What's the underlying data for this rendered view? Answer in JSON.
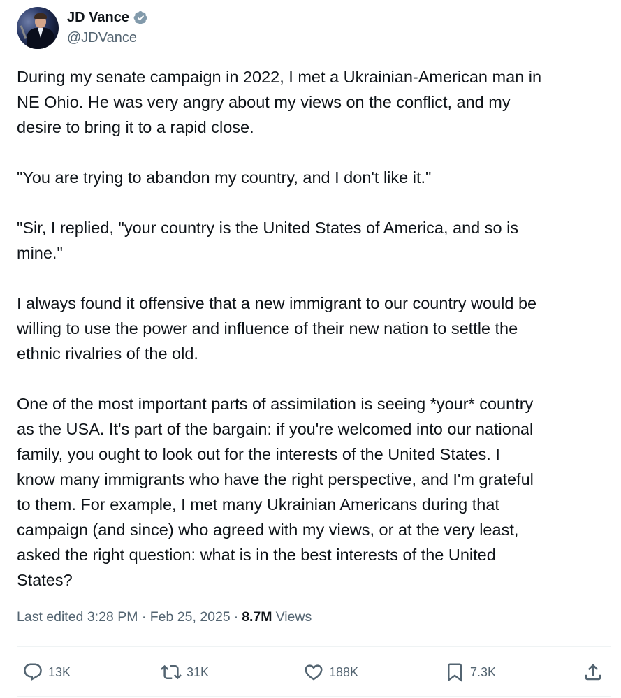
{
  "author": {
    "display_name": "JD Vance",
    "handle": "@JDVance",
    "verified_badge": "verified-badge-icon",
    "badge_color": "#829aab"
  },
  "tweet": {
    "paragraphs": [
      "During my senate campaign in 2022, I met a Ukrainian-American man in\nNE Ohio. He was very angry about my views on the conflict, and my\ndesire to bring it to a rapid close.",
      "\"You are trying to abandon my country, and I don't like it.\"",
      "\"Sir, I replied, \"your country is the United States of America, and so is\nmine.\"",
      "I always found it offensive that a new immigrant to our country would be\nwilling to use the power and influence of their new nation to settle the\nethnic rivalries of the old.",
      "One of the most important parts of assimilation is seeing *your* country\nas the USA. It's part of the bargain: if you're welcomed into our national\nfamily, you ought to look out for the interests of the United States.  I\nknow many immigrants who have the right perspective, and I'm grateful\nto them. For example, I met many Ukrainian Americans during that\ncampaign (and since) who agreed with my views, or at the very least,\nasked the right question: what is in the best interests of the United\nStates?"
    ]
  },
  "meta": {
    "timestamp": "Last edited 3:28 PM · Feb 25, 2025",
    "separator": "·",
    "views_count": "8.7M",
    "views_label": "Views"
  },
  "actions": {
    "reply_count": "13K",
    "retweet_count": "31K",
    "like_count": "188K",
    "bookmark_count": "7.3K",
    "icons": [
      "reply-icon",
      "retweet-icon",
      "like-icon",
      "bookmark-icon",
      "share-icon"
    ]
  },
  "colors": {
    "text_primary": "#0f1419",
    "text_secondary": "#536471",
    "divider": "#eff3f4"
  }
}
